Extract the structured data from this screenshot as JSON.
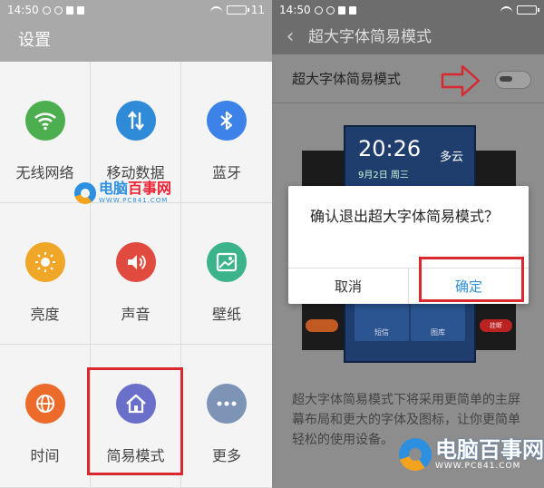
{
  "left": {
    "status": {
      "time": "14:50",
      "battery": "11"
    },
    "title": "设置",
    "grid": [
      {
        "label": "无线网络",
        "icon": "wifi-icon",
        "color": "#4cae4f"
      },
      {
        "label": "移动数据",
        "icon": "mobile-data-icon",
        "color": "#2f8ad8"
      },
      {
        "label": "蓝牙",
        "icon": "bluetooth-icon",
        "color": "#3d82e8"
      },
      {
        "label": "亮度",
        "icon": "brightness-icon",
        "color": "#f0a627"
      },
      {
        "label": "声音",
        "icon": "sound-icon",
        "color": "#e04a3f"
      },
      {
        "label": "壁纸",
        "icon": "wallpaper-icon",
        "color": "#3bb38b"
      },
      {
        "label": "时间",
        "icon": "globe-icon",
        "color": "#ec6a2a"
      },
      {
        "label": "简易模式",
        "icon": "home-icon",
        "color": "#6a6fc9"
      },
      {
        "label": "更多",
        "icon": "more-icon",
        "color": "#7d94b6"
      }
    ]
  },
  "right": {
    "status": {
      "time": "14:50",
      "battery": ""
    },
    "title": "超大字体简易模式",
    "setting_label": "超大字体简易模式",
    "preview": {
      "time": "20:26",
      "date": "9月2日 周三",
      "weather": "多云",
      "app1": "短信",
      "app2": "图库",
      "call_btn": "挂断"
    },
    "dialog": {
      "message": "确认退出超大字体简易模式？",
      "cancel": "取消",
      "confirm": "确定"
    },
    "description": "超大字体简易模式下将采用更简单的主屏幕布局和更大的字体及图标，让你更简单轻松的使用设备。"
  },
  "watermark": {
    "brand_a": "电脑",
    "brand_b": "百事网",
    "url": "WWW.PC841.COM"
  },
  "colors": {
    "highlight": "#d9282f",
    "accent": "#2f8fd8"
  }
}
